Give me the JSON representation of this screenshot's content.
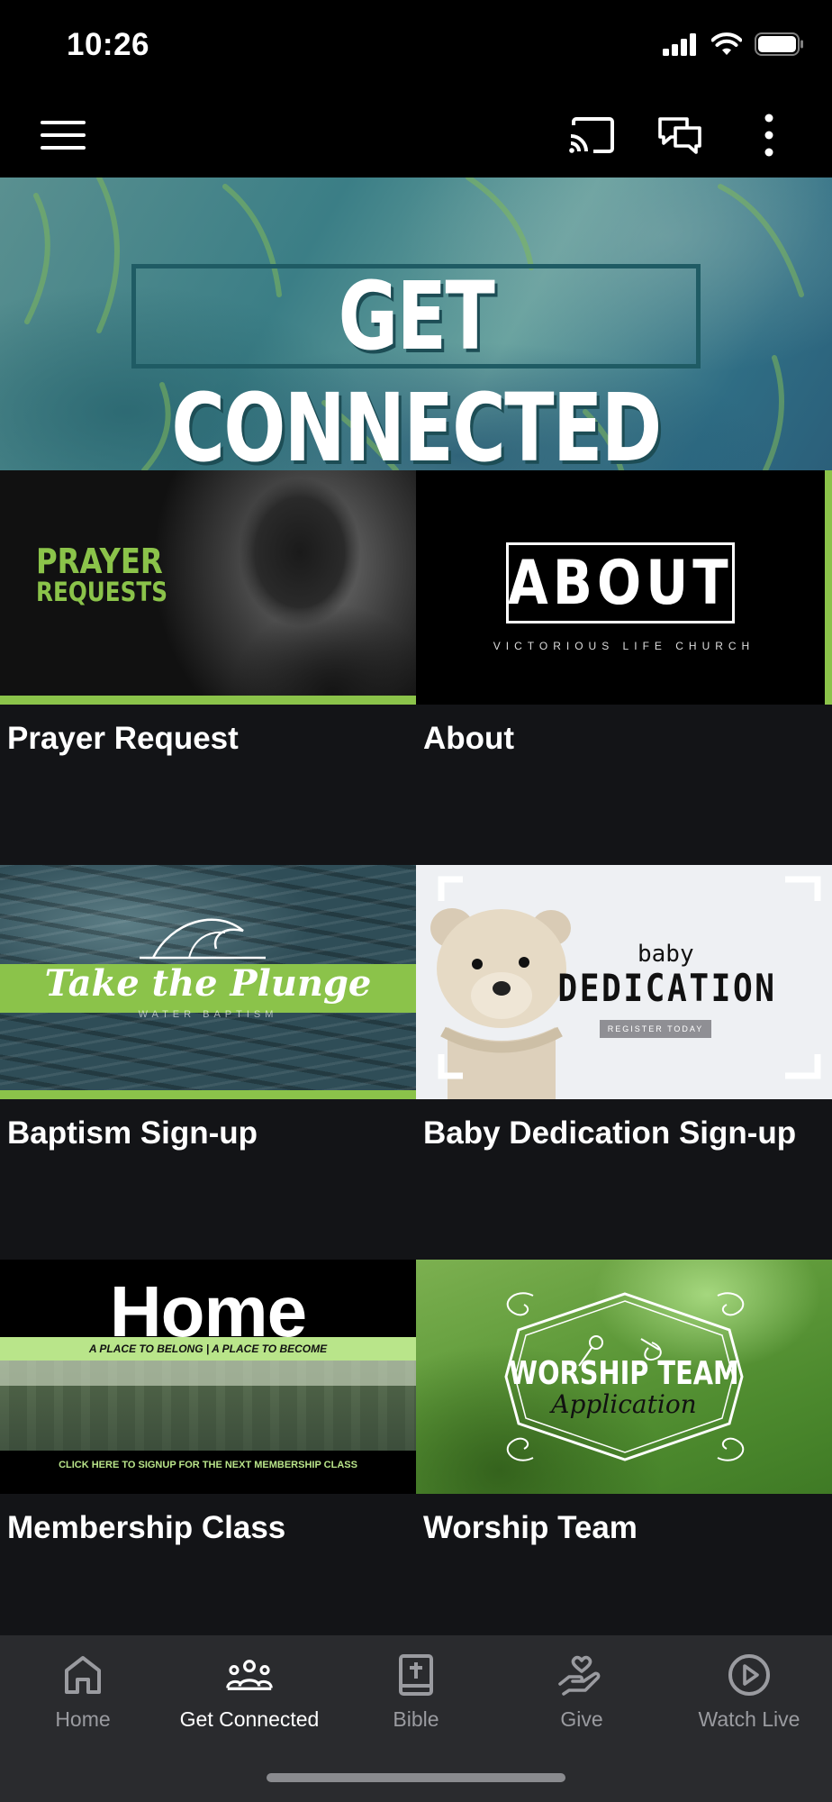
{
  "status_bar": {
    "time": "10:26"
  },
  "app_bar": {
    "menu_icon": "hamburger-menu-icon",
    "actions": [
      "cast-icon",
      "chat-icon",
      "more-vertical-icon"
    ]
  },
  "hero": {
    "title": "GET CONNECTED"
  },
  "tiles": [
    {
      "label": "Prayer Request",
      "image_text": [
        "PRAYER",
        "REQUESTS"
      ]
    },
    {
      "label": "About",
      "image_text": [
        "ABOUT",
        "VICTORIOUS LIFE CHURCH"
      ]
    },
    {
      "label": "Baptism Sign-up",
      "image_text": [
        "Take the Plunge",
        "WATER BAPTISM"
      ]
    },
    {
      "label": "Baby Dedication Sign-up",
      "image_text": [
        "baby",
        "DEDICATION",
        "REGISTER TODAY"
      ]
    },
    {
      "label": "Membership Class",
      "image_text": [
        "Home",
        "A PLACE TO BELONG | A PLACE TO BECOME",
        "CLICK HERE TO SIGNUP FOR THE NEXT MEMBERSHIP CLASS"
      ]
    },
    {
      "label": "Worship Team",
      "image_text": [
        "WORSHIP TEAM",
        "Application"
      ]
    }
  ],
  "bottom_nav": {
    "items": [
      {
        "label": "Home",
        "icon": "home-icon",
        "active": false
      },
      {
        "label": "Get Connected",
        "icon": "people-group-icon",
        "active": true
      },
      {
        "label": "Bible",
        "icon": "bible-icon",
        "active": false
      },
      {
        "label": "Give",
        "icon": "give-hand-heart-icon",
        "active": false
      },
      {
        "label": "Watch Live",
        "icon": "play-circle-icon",
        "active": false
      }
    ]
  },
  "colors": {
    "accent_green": "#8bc34a",
    "background": "#131417",
    "nav_background": "#2a2b2e"
  }
}
